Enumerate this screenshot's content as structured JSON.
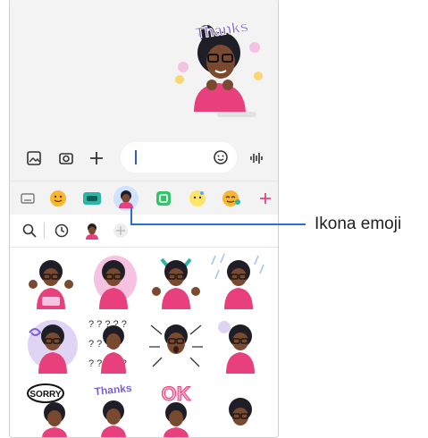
{
  "chat": {
    "sticker_text": "Thanks",
    "sent_sticker_name": "thanks-sticker"
  },
  "input_bar": {
    "icons": [
      "gallery-icon",
      "camera-icon",
      "plus-icon",
      "emoji-icon",
      "voice-icon"
    ]
  },
  "emoji_tabs": {
    "items": [
      "keyboard",
      "emoji",
      "sticker-pack",
      "ar-emoji",
      "gif",
      "sticker-2",
      "face-sticker",
      "add"
    ],
    "selected_index": 3
  },
  "sub_tabs": {
    "items": [
      "search",
      "recent",
      "ar-emoji",
      "add"
    ]
  },
  "sticker_grid": {
    "rows": [
      [
        "cake-wave",
        "kiss-heart",
        "party-arms",
        "rain-sad"
      ],
      [
        "dizzy",
        "question-marks",
        "shock",
        "celebrate"
      ],
      [
        "sorry",
        "thanks",
        "ok",
        "smile"
      ]
    ],
    "texts": {
      "sorry": "SORRY",
      "thanks": "Thanks",
      "ok": "OK"
    }
  },
  "callout": {
    "label": "Ikona emoji"
  },
  "colors": {
    "accent": "#2a6fd2",
    "selected_tab_bg": "#cfe2ff",
    "avatar_shirt": "#e8407d",
    "avatar_skin": "#7a4a30",
    "thanks_purple": "#7b5fd0"
  }
}
